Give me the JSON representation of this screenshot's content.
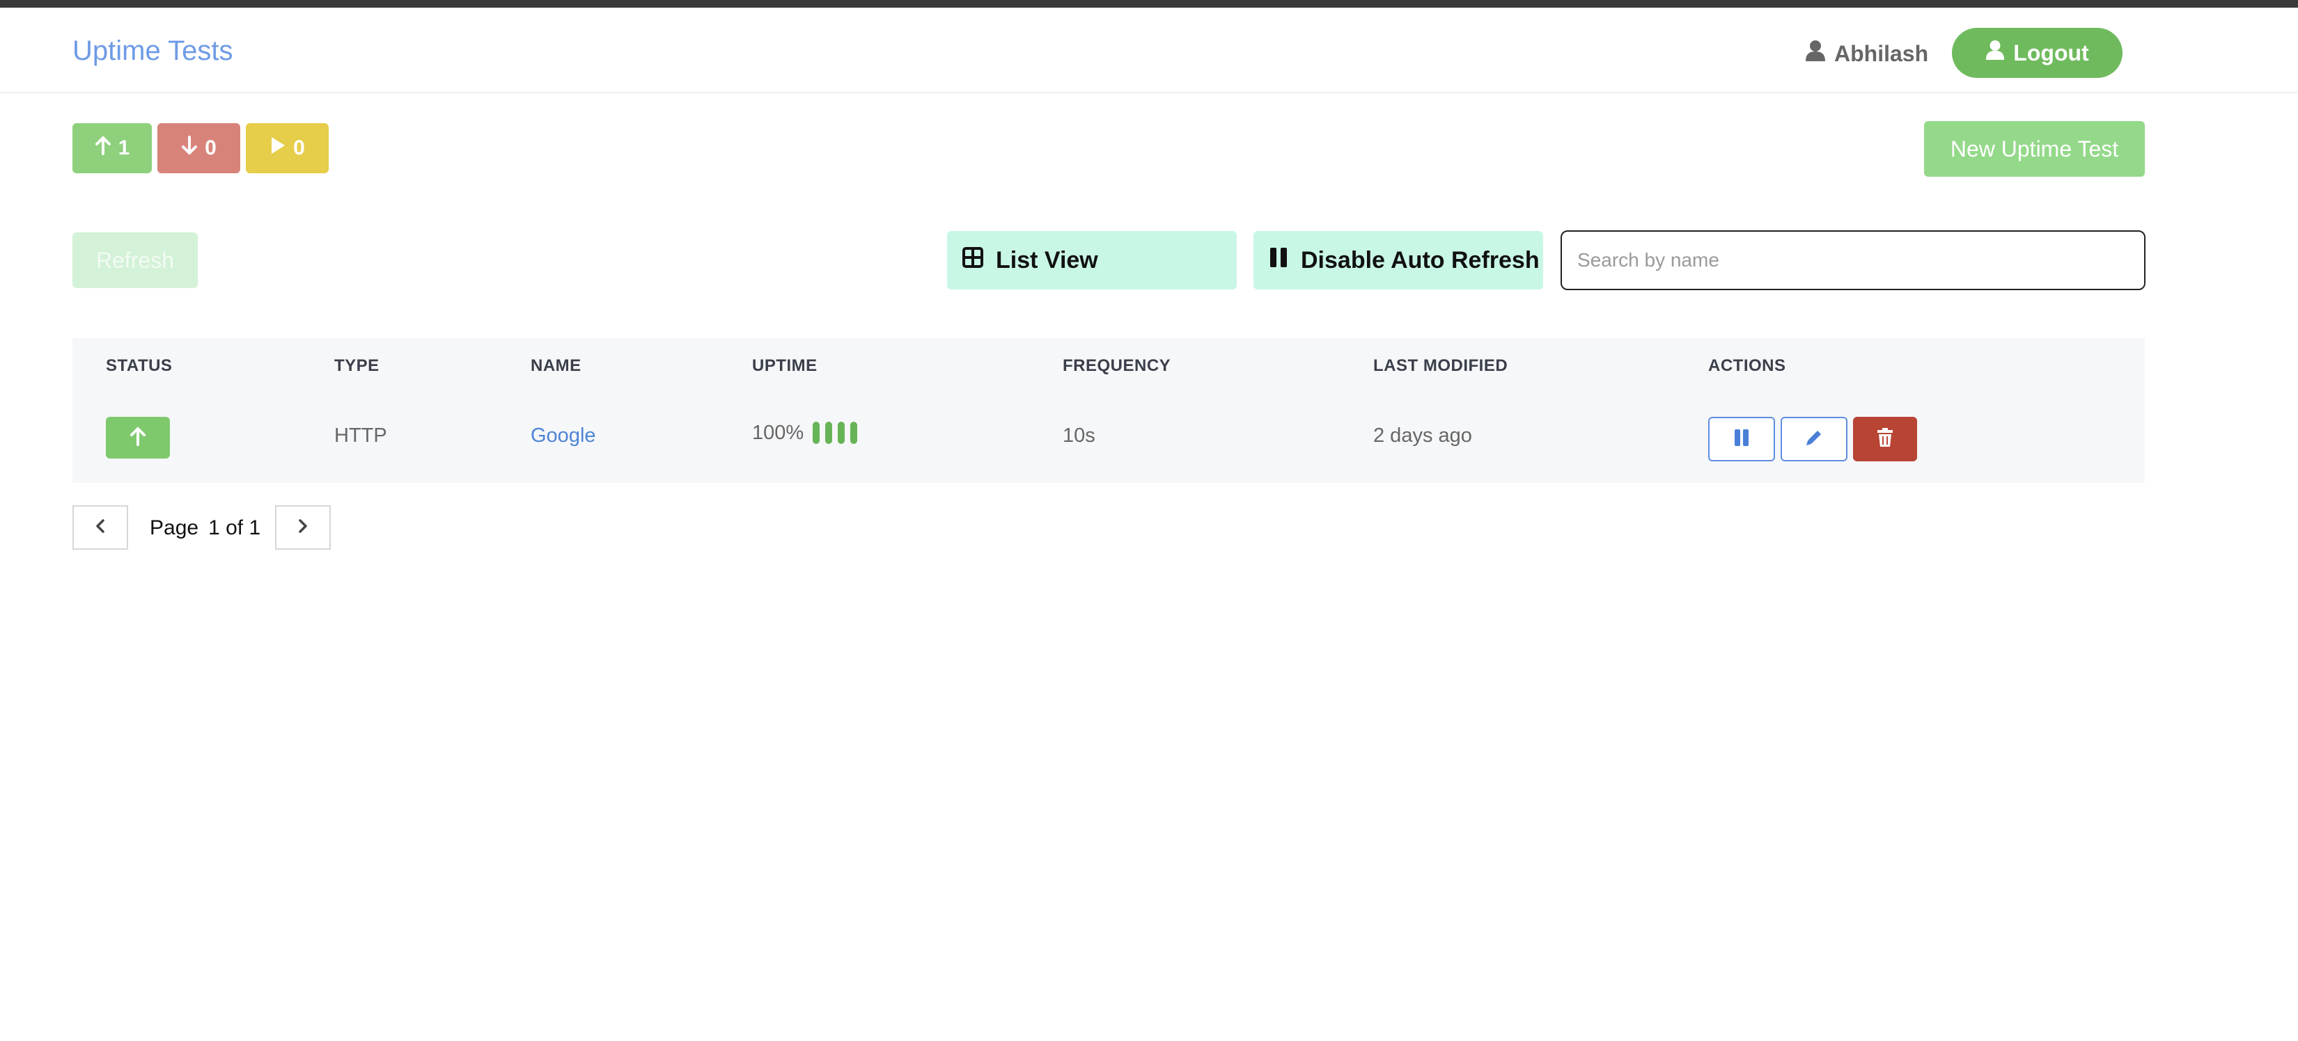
{
  "header": {
    "app_title": "Uptime Tests",
    "user_name": "Abhilash",
    "logout_label": "Logout"
  },
  "summary": {
    "up_count": "1",
    "down_count": "0",
    "running_count": "0"
  },
  "toolbar": {
    "new_test_label": "New Uptime Test",
    "refresh_label": "Refresh",
    "list_view_label": "List View",
    "auto_refresh_label": "Disable Auto Refresh",
    "search_placeholder": "Search by name"
  },
  "table": {
    "columns": [
      "STATUS",
      "TYPE",
      "NAME",
      "UPTIME",
      "FREQUENCY",
      "LAST MODIFIED",
      "ACTIONS"
    ],
    "rows": [
      {
        "status": "up",
        "type": "HTTP",
        "name": "Google",
        "uptime": "100%",
        "frequency": "10s",
        "last_modified": "2 days ago"
      }
    ]
  },
  "pagination": {
    "page_label": "Page",
    "page_value": "1 of 1"
  },
  "colors": {
    "accent_blue": "#6e9be6",
    "up_green": "#8ed07c",
    "down_red": "#d8837a",
    "running_yellow": "#e6cd4a",
    "delete_red": "#b84434"
  },
  "icons": {
    "user": "user-icon",
    "arrow_up": "arrow-up-icon",
    "arrow_down": "arrow-down-icon",
    "play": "play-icon",
    "grid": "grid-icon",
    "pause": "pause-icon",
    "edit": "pencil-icon",
    "delete": "trash-icon",
    "prev": "chevron-left-icon",
    "next": "chevron-right-icon"
  }
}
